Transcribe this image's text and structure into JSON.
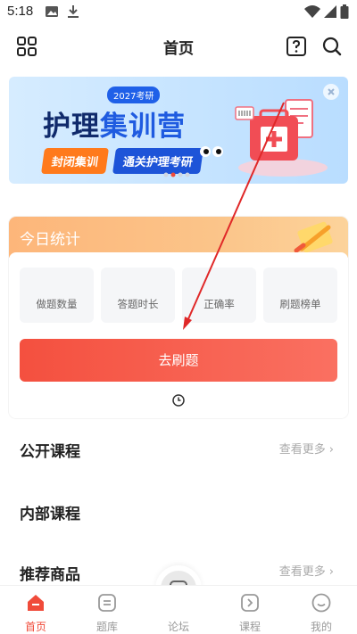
{
  "status_bar": {
    "time": "5:18"
  },
  "header": {
    "title": "首页"
  },
  "banner": {
    "year_badge": "2027考研",
    "title_part1": "护理",
    "title_part2": "集训营",
    "tag1": "封闭集训",
    "tag2": "通关护理考研"
  },
  "stats": {
    "title": "今日统计",
    "metrics": [
      "做题数量",
      "答题时长",
      "正确率",
      "刷题榜单"
    ],
    "practice_button": "去刷题"
  },
  "sections": {
    "public_courses": "公开课程",
    "internal_courses": "内部课程",
    "recommended_products": "推荐商品",
    "see_more": "查看更多"
  },
  "nav": {
    "items": [
      "首页",
      "题库",
      "论坛",
      "课程",
      "我的"
    ]
  },
  "colors": {
    "accent_red": "#f04b3a",
    "banner_blue": "#1f5be0",
    "stats_orange": "#fdb67a",
    "annotation_arrow": "#e02828"
  },
  "icons": {
    "header_left": "grid-apps-icon",
    "header_help": "question-mark-icon",
    "header_search": "search-icon",
    "stats_clock": "clock-icon"
  }
}
